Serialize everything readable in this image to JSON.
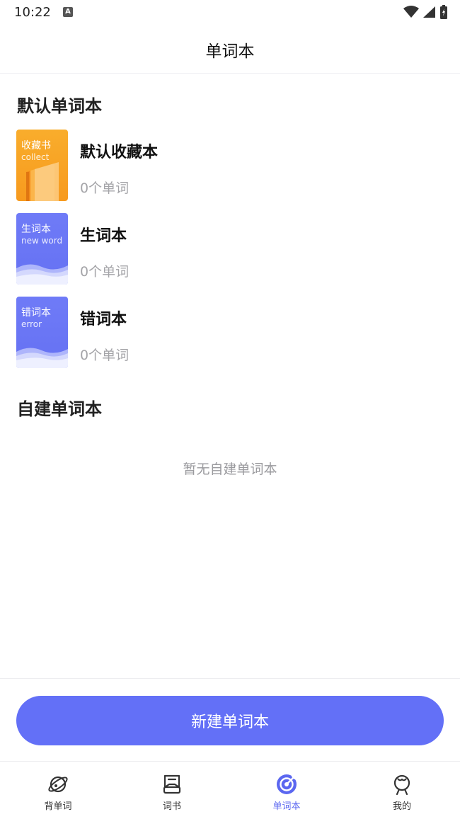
{
  "status_bar": {
    "time": "10:22",
    "notification_badge": "A"
  },
  "header": {
    "title": "单词本"
  },
  "default_section": {
    "title": "默认单词本",
    "books": [
      {
        "name": "默认收藏本",
        "count_text": "0个单词",
        "cover_cn": "收藏书",
        "cover_en": "collect",
        "cover_color": "#f7a325"
      },
      {
        "name": "生词本",
        "count_text": "0个单词",
        "cover_cn": "生词本",
        "cover_en": "new word",
        "cover_color": "#6b77f5"
      },
      {
        "name": "错词本",
        "count_text": "0个单词",
        "cover_cn": "错词本",
        "cover_en": "error",
        "cover_color": "#6b77f5"
      }
    ]
  },
  "custom_section": {
    "title": "自建单词本",
    "empty_text": "暂无自建单词本"
  },
  "create_button": {
    "label": "新建单词本"
  },
  "tab_bar": {
    "tabs": [
      {
        "label": "背单词",
        "icon": "planet-icon",
        "active": false
      },
      {
        "label": "词书",
        "icon": "book-icon",
        "active": false
      },
      {
        "label": "单词本",
        "icon": "target-icon",
        "active": true
      },
      {
        "label": "我的",
        "icon": "profile-icon",
        "active": false
      }
    ]
  },
  "colors": {
    "accent": "#6370f7",
    "active_tab": "#5b67f0"
  }
}
